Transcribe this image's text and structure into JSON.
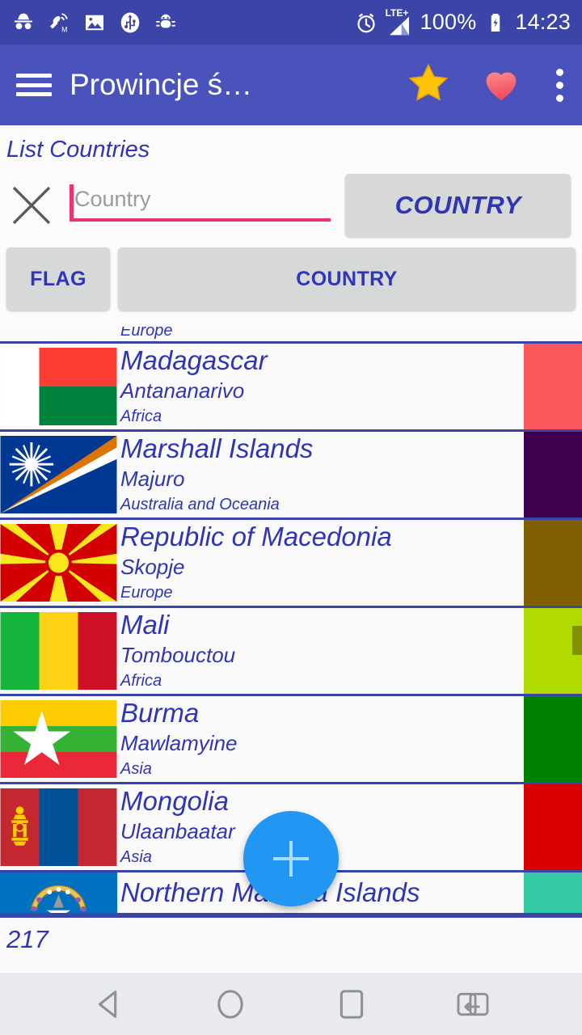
{
  "status_bar": {
    "icons": [
      "incognito-icon",
      "mock-location-icon",
      "screenshot-icon",
      "usb-icon",
      "debug-bug-icon"
    ],
    "alarm_icon": "alarm-clock-icon",
    "network_label": "LTE+",
    "battery_percent": "100%",
    "battery_icon": "battery-charging-icon",
    "time": "14:23",
    "background": "#3b45a8"
  },
  "app_bar": {
    "menu_icon": "hamburger-menu-icon",
    "title": "Prowincje ś…",
    "star_icon": "star-icon",
    "heart_icon": "heart-icon",
    "overflow_icon": "overflow-menu-icon",
    "background": "#4a53bb"
  },
  "filter_panel": {
    "title": "List Countries",
    "clear_icon": "clear-x-icon",
    "search": {
      "value": "",
      "placeholder": "Country"
    },
    "search_button_label": "COUNTRY",
    "sort_buttons": [
      {
        "label": "FLAG",
        "name": "sort-flag-button"
      },
      {
        "label": "COUNTRY",
        "name": "sort-country-button"
      }
    ],
    "accent": "#e8356d",
    "button_bg": "#d7d9d9",
    "text_color": "#2f35b5"
  },
  "list": {
    "partial_top": {
      "region": "Europe",
      "swatch": "#800000"
    },
    "rows": [
      {
        "country": "Madagascar",
        "capital": "Antananarivo",
        "region": "Africa",
        "swatch": "#fb5a5a",
        "flag": "madagascar"
      },
      {
        "country": "Marshall Islands",
        "capital": "Majuro",
        "region": "Australia and Oceania",
        "swatch": "#400050",
        "flag": "marshall-islands"
      },
      {
        "country": "Republic of Macedonia",
        "capital": "Skopje",
        "region": "Europe",
        "swatch": "#806000",
        "flag": "macedonia"
      },
      {
        "country": "Mali",
        "capital": "Tombouctou",
        "region": "Africa",
        "swatch": "#b0da00",
        "flag": "mali"
      },
      {
        "country": "Burma",
        "capital": "Mawlamyine",
        "region": "Asia",
        "swatch": "#008000",
        "flag": "burma"
      },
      {
        "country": "Mongolia",
        "capital": "Ulaanbaatar",
        "region": "Asia",
        "swatch": "#d80000",
        "flag": "mongolia"
      }
    ],
    "partial_bottom": {
      "country": "Northern Mariana Islands",
      "swatch": "#34c8a4",
      "flag": "northern-mariana-islands"
    },
    "divider_color": "#3b45a8",
    "scrollbar_color": "#7c8200"
  },
  "fab": {
    "icon": "plus-icon",
    "color": "#2196f3"
  },
  "count_bar": {
    "count": "217"
  },
  "nav_bar": {
    "back_icon": "back-triangle-icon",
    "home_icon": "home-circle-icon",
    "recents_icon": "recents-square-icon",
    "switch_icon": "switch-apps-icon",
    "background": "#e8eaed"
  }
}
